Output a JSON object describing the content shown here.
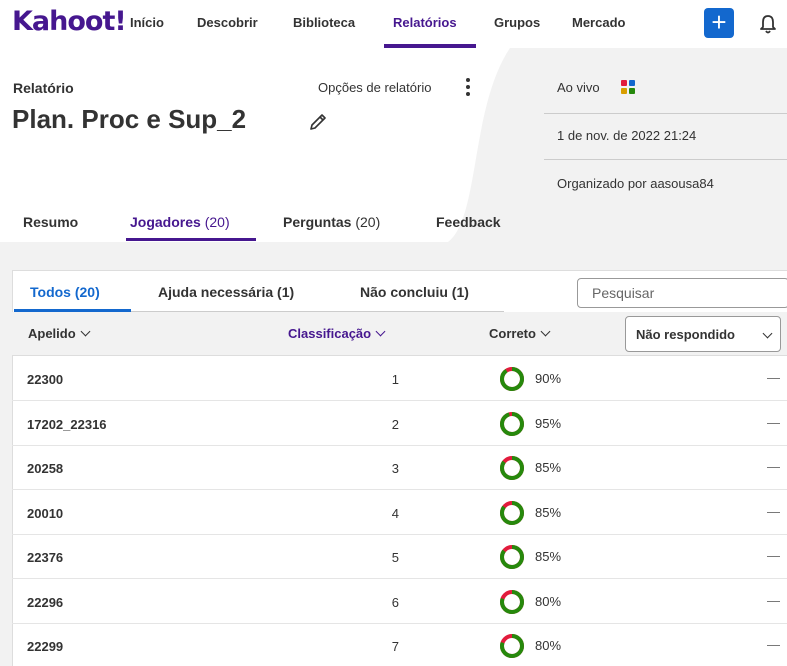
{
  "nav": {
    "logo": "Kahoot!",
    "items": [
      "Início",
      "Descobrir",
      "Biblioteca",
      "Relatórios",
      "Grupos",
      "Mercado"
    ],
    "active": "Relatórios",
    "plus": "+"
  },
  "report": {
    "label": "Relatório",
    "title": "Plan. Proc e Sup_2",
    "options_label": "Opções de relatório",
    "live_label": "Ao vivo",
    "date": "1 de nov. de 2022 21:24",
    "organizer": "Organizado por aasousa84"
  },
  "tabs": [
    {
      "label": "Resumo",
      "count": ""
    },
    {
      "label": "Jogadores",
      "count": "(20)"
    },
    {
      "label": "Perguntas",
      "count": "(20)"
    },
    {
      "label": "Feedback",
      "count": ""
    }
  ],
  "filters": [
    "Todos (20)",
    "Ajuda necessária (1)",
    "Não concluiu (1)"
  ],
  "search": {
    "placeholder": "Pesquisar"
  },
  "columns": {
    "nickname": "Apelido",
    "rank": "Classificação",
    "correct": "Correto",
    "unanswered": "Não respondido"
  },
  "colors": {
    "brand": "#46178f",
    "blue": "#1368ce",
    "correct": "#26890c",
    "incorrect": "#e21b3c"
  },
  "rows": [
    {
      "name": "22300",
      "rank": "1",
      "pct": "90%",
      "value": 90,
      "dash": "—"
    },
    {
      "name": "17202_22316",
      "rank": "2",
      "pct": "95%",
      "value": 95,
      "dash": "—"
    },
    {
      "name": "20258",
      "rank": "3",
      "pct": "85%",
      "value": 85,
      "dash": "—"
    },
    {
      "name": "20010",
      "rank": "4",
      "pct": "85%",
      "value": 85,
      "dash": "—"
    },
    {
      "name": "22376",
      "rank": "5",
      "pct": "85%",
      "value": 85,
      "dash": "—"
    },
    {
      "name": "22296",
      "rank": "6",
      "pct": "80%",
      "value": 80,
      "dash": "—"
    },
    {
      "name": "22299",
      "rank": "7",
      "pct": "80%",
      "value": 80,
      "dash": "—"
    }
  ]
}
